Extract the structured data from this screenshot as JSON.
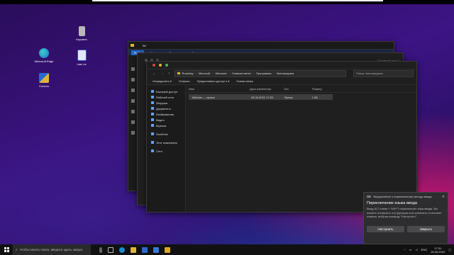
{
  "desktop": {
    "icons": [
      {
        "label": "Корзина"
      },
      {
        "label": "Microsoft Edge"
      },
      {
        "label": "mac os"
      },
      {
        "label": "Cursors"
      }
    ]
  },
  "back_window": {
    "title": "Bif",
    "ribbon": {
      "file": "Файл",
      "home": "Главная",
      "share": "Поделиться",
      "view": "Вид"
    }
  },
  "mid_window": {
    "search_placeholder": "Основной диск С"
  },
  "front_window": {
    "path": [
      "Roaming",
      "Microsoft",
      "Windows",
      "Главное меню",
      "Программы",
      "Автозагрузка"
    ],
    "search_placeholder": "Поиск: Автозагрузка",
    "commands": {
      "organize": "Упорядочить ▾",
      "open": "Открыть",
      "share": "Предоставить доступ к ▾",
      "new_folder": "Новая папка"
    },
    "nav": [
      {
        "label": "Быстрый доступ"
      },
      {
        "label": "Рабочий стол"
      },
      {
        "label": "Загрузки"
      },
      {
        "label": "Документы"
      },
      {
        "label": "Изображения"
      },
      {
        "label": "Видео"
      },
      {
        "label": "Музыка"
      },
      {
        "label": "OneDrive"
      },
      {
        "label": "Этот компьютер"
      },
      {
        "label": "Сеть"
      }
    ],
    "columns": {
      "name": "Имя",
      "date": "Дата изменения",
      "type": "Тип",
      "size": "Размер"
    },
    "rows": [
      {
        "name": "Taifolder — ярлык",
        "date": "28.06.2022 17:53",
        "type": "Ярлык",
        "size": "1 КБ"
      }
    ]
  },
  "toast": {
    "header": "Уведомление о переключении метода ввода",
    "title": "Переключение языка ввода",
    "body": "Ввод ALT слева + SHIFT переключает язык ввода. Вы можете отключить эту функцию или изменить сочетание клавиш, выбрав команду \"Настроить\".",
    "configure": "Настроить",
    "close": "Закрыть"
  },
  "taskbar": {
    "search_placeholder": "Чтобы начать поиск, введите здесь запрос",
    "lang": "ENG",
    "time": "17:51",
    "date": "28.06.2022"
  },
  "colors": {
    "accent": "#2a6ad0",
    "close": "#e0443c",
    "min": "#e0b33c",
    "max": "#3cc15a"
  }
}
